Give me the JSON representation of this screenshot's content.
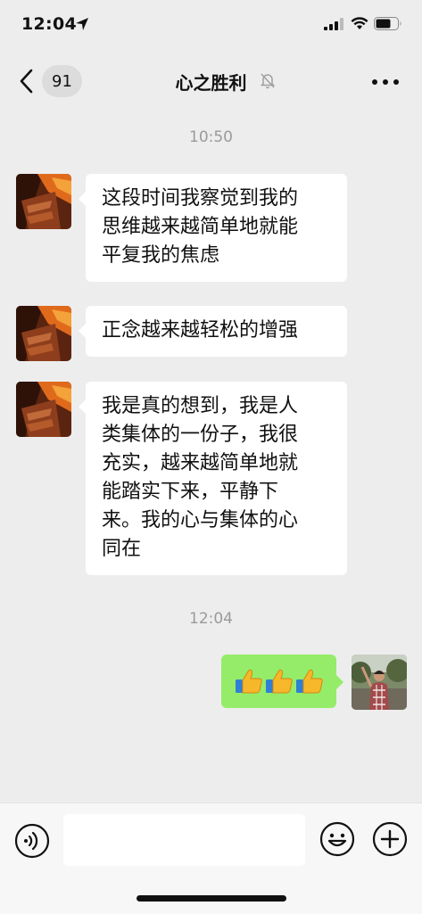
{
  "status_bar": {
    "time": "12:04"
  },
  "nav": {
    "back_count": "91",
    "title": "心之胜利"
  },
  "messages": [
    {
      "timestamp": "10:50"
    },
    {
      "sender": "other",
      "lines": [
        "这段时间我察觉到我的",
        "思维越来越简单地就能",
        "平复我的焦虑"
      ]
    },
    {
      "sender": "other",
      "lines": [
        "正念越来越轻松的增强"
      ]
    },
    {
      "sender": "other",
      "lines": [
        "我是真的想到，我是人",
        "类集体的一份子，我很",
        "充实，越来越简单地就",
        "能踏实下来，平静下",
        "来。我的心与集体的心",
        "同在"
      ]
    },
    {
      "timestamp": "12:04"
    },
    {
      "sender": "self",
      "emoji": "👍👍👍"
    }
  ],
  "input": {
    "placeholder": ""
  },
  "colors": {
    "self_bubble": "#95ec69",
    "other_bubble": "#ffffff",
    "background": "#ededed"
  }
}
